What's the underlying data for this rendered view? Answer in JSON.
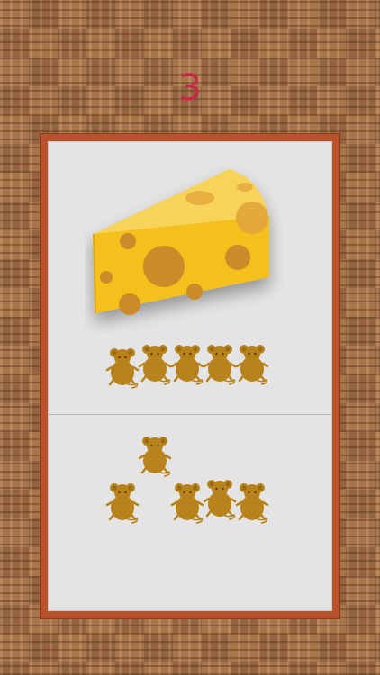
{
  "game": {
    "counter": "3",
    "target_item": "cheese",
    "top_row": {
      "mice": 5
    },
    "bottom_area": {
      "mice": 5
    }
  },
  "colors": {
    "counter": "#c9274a",
    "board_frame": "#b9532e",
    "board_surface": "#e4e4e4",
    "cheese": "#f5bf1c",
    "cheese_holes": "#cc8a2a",
    "mouse": "#b8821c"
  }
}
